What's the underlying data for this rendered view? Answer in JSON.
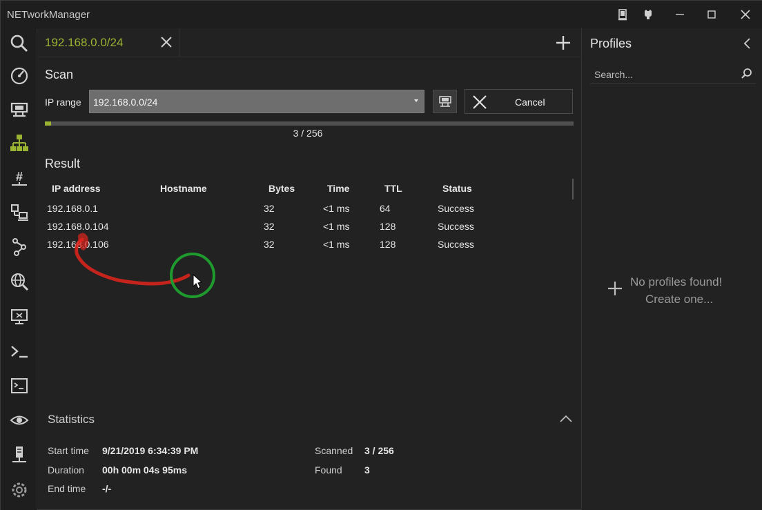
{
  "app": {
    "title": "NETworkManager"
  },
  "tab": {
    "label": "192.168.0.0/24"
  },
  "scan": {
    "title": "Scan",
    "ip_range_label": "IP range",
    "ip_range_value": "192.168.0.0/24",
    "cancel_label": "Cancel",
    "progress_fraction": 0.0117,
    "progress_text": "3 / 256"
  },
  "result": {
    "title": "Result",
    "columns": [
      "IP address",
      "Hostname",
      "Bytes",
      "Time",
      "TTL",
      "Status"
    ],
    "rows": [
      {
        "ip": "192.168.0.1",
        "hostname": "",
        "bytes": "32",
        "time": "<1 ms",
        "ttl": "64",
        "status": "Success"
      },
      {
        "ip": "192.168.0.104",
        "hostname": "",
        "bytes": "32",
        "time": "<1 ms",
        "ttl": "128",
        "status": "Success"
      },
      {
        "ip": "192.168.0.106",
        "hostname": "",
        "bytes": "32",
        "time": "<1 ms",
        "ttl": "128",
        "status": "Success"
      }
    ]
  },
  "statistics": {
    "title": "Statistics",
    "start_time_label": "Start time",
    "start_time_value": "9/21/2019 6:34:39 PM",
    "duration_label": "Duration",
    "duration_value": "00h 00m 04s 95ms",
    "end_time_label": "End time",
    "end_time_value": "-/-",
    "scanned_label": "Scanned",
    "scanned_value": "3 / 256",
    "found_label": "Found",
    "found_value": "3"
  },
  "profiles": {
    "title": "Profiles",
    "search_placeholder": "Search...",
    "empty_line1": "No profiles found!",
    "empty_line2": "Create one..."
  },
  "nav": {
    "items": [
      "search-icon",
      "dashboard-icon",
      "network-interface-icon",
      "ip-scanner-icon",
      "port-scanner-icon",
      "ping-monitor-icon",
      "traceroute-icon",
      "dns-lookup-icon",
      "remote-desktop-icon",
      "powershell-icon",
      "putty-icon",
      "tightvnc-icon",
      "server-icon",
      "settings-icon"
    ],
    "active": "ip-scanner-icon"
  },
  "colors": {
    "accent": "#9bb332",
    "background": "#222222",
    "annotation_red": "#e0241b",
    "annotation_green": "#1f9a2e"
  }
}
